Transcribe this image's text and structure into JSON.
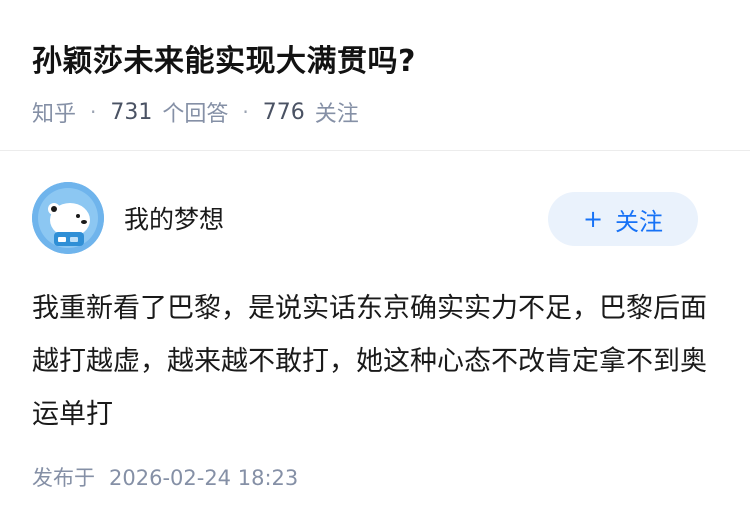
{
  "question": {
    "title": "孙颖莎未来能实现大满贯吗?",
    "source": "知乎",
    "answer_count": "731",
    "answer_label": "个回答",
    "follow_count": "776",
    "follow_label": "关注"
  },
  "author": {
    "name": "我的梦想",
    "avatar_icon": "polar-bear-avatar-icon",
    "follow_button_label": "关注",
    "follow_button_icon": "plus-icon"
  },
  "answer": {
    "text": "我重新看了巴黎，是说实话东京确实实力不足，巴黎后面越打越虚，越来越不敢打，她这种心态不改肯定拿不到奥运单打"
  },
  "footer": {
    "published_label": "发布于",
    "published_time": "2026-02-24 18:23"
  },
  "colors": {
    "accent": "#1772f6",
    "button_bg": "#eaf2fc",
    "meta_text": "#8590a6",
    "avatar_bg": "#6fb4ec"
  }
}
